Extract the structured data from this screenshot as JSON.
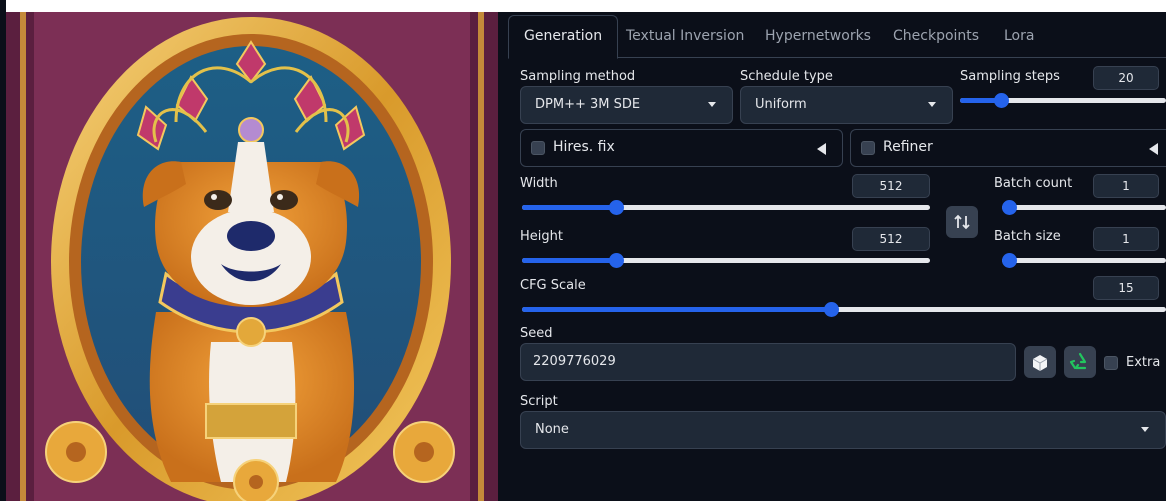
{
  "tabs": [
    {
      "label": "Generation"
    },
    {
      "label": "Textual Inversion"
    },
    {
      "label": "Hypernetworks"
    },
    {
      "label": "Checkpoints"
    },
    {
      "label": "Lora"
    }
  ],
  "sampling": {
    "method_label": "Sampling method",
    "method_value": "DPM++ 3M SDE",
    "schedule_label": "Schedule type",
    "schedule_value": "Uniform",
    "steps_label": "Sampling steps",
    "steps_value": "20",
    "steps_fraction": 0.2
  },
  "accordions": {
    "hires_label": "Hires. fix",
    "refiner_label": "Refiner"
  },
  "size": {
    "width_label": "Width",
    "width_value": "512",
    "width_fraction": 0.23,
    "height_label": "Height",
    "height_value": "512",
    "height_fraction": 0.23
  },
  "batch": {
    "count_label": "Batch count",
    "count_value": "1",
    "count_fraction": 0.0,
    "size_label": "Batch size",
    "size_value": "1",
    "size_fraction": 0.0
  },
  "cfg": {
    "label": "CFG Scale",
    "value": "15",
    "fraction": 0.48
  },
  "seed": {
    "label": "Seed",
    "value": "2209776029",
    "extra_label": "Extra"
  },
  "script": {
    "label": "Script",
    "value": "None"
  },
  "colors": {
    "accent": "#2563eb",
    "panel_bg": "#0b0f19",
    "input_bg": "#1f2937",
    "border": "#374151"
  }
}
